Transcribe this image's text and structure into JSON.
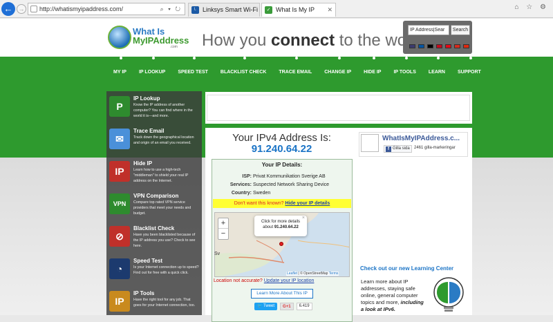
{
  "browser": {
    "url": "http://whatismyipaddress.com/",
    "address_controls": "⌕ ▾ ↻",
    "tabs": [
      {
        "label": "Linksys Smart Wi-Fi",
        "favicon": "ᴸ"
      },
      {
        "label": "What Is My IP Address? IP A...",
        "favicon": "✓",
        "close": "✕"
      }
    ],
    "window_icons": "⌂ ☆ ⚙"
  },
  "header": {
    "logo_line1": "What Is",
    "logo_line2": "MyIPAddress",
    "logo_dotcom": ".com",
    "tagline_pre": "How you ",
    "tagline_bold": "connect",
    "tagline_post": " to the world",
    "search_placeholder": "IP Address|Sear",
    "search_button": "Search",
    "flag_colors": [
      "#3c3b6e",
      "#0055a4",
      "#000000",
      "#c60b1e",
      "#e30a17",
      "#d52b1e",
      "#de2910"
    ]
  },
  "nav": [
    "MY IP",
    "IP LOOKUP",
    "SPEED TEST",
    "BLACKLIST CHECK",
    "TRACE EMAIL",
    "CHANGE IP",
    "HIDE IP",
    "IP TOOLS",
    "LEARN",
    "SUPPORT"
  ],
  "sidebar": [
    {
      "title": "IP Lookup",
      "desc": "Know the IP address of another computer? You can find where in the world it is—and more.",
      "icon": "lookup-icon",
      "glyph": "P",
      "color": "#2e8b2e"
    },
    {
      "title": "Trace Email",
      "desc": "Track down the geographical location and origin of an email you received.",
      "icon": "map-pin-icon",
      "glyph": "✉",
      "color": "#4a90d9"
    },
    {
      "title": "Hide IP",
      "desc": "Learn how to use a high-tech \"middleman\" to shield your real IP address on the Internet.",
      "icon": "incognito-icon",
      "glyph": "IP",
      "color": "#c0302a"
    },
    {
      "title": "VPN Comparison",
      "desc": "Compare top rated VPN service providers that meet your needs and budget.",
      "icon": "vpn-icon",
      "glyph": "VPN",
      "color": "#2e8b2e"
    },
    {
      "title": "Blacklist Check",
      "desc": "Have you been blacklisted because of the IP address you use? Check to see here.",
      "icon": "blacklist-icon",
      "glyph": "⊘",
      "color": "#c0302a"
    },
    {
      "title": "Speed Test",
      "desc": "Is your Internet connection up to speed? Find out for free with a quick click.",
      "icon": "speedometer-icon",
      "glyph": "◔",
      "color": "#1c3a6e"
    },
    {
      "title": "IP Tools",
      "desc": "Have the right tool for any job. That goes for your Internet connection, too.",
      "icon": "toolbox-icon",
      "glyph": "IP",
      "color": "#c98a1e"
    }
  ],
  "main": {
    "ip_title": "Your IPv4 Address Is:",
    "ip_address": "91.240.64.22",
    "details_title": "Your IP Details:",
    "isp_label": "ISP:",
    "isp_value": "Privat Kommunikation Sverige AB",
    "services_label": "Services:",
    "services_value": "Suspected Network Sharing Device",
    "country_label": "Country:",
    "country_value": "Sweden",
    "warn_text": "Don't want this known?",
    "warn_link": "Hide your IP details",
    "popup_line1": "Click for more details",
    "popup_line2_pre": "about ",
    "popup_ip": "91.240.64.22",
    "map_label": "Sv",
    "map_attrib_leaflet": "Leaflet",
    "map_attrib_sep": " | © OpenStreetMap ",
    "map_attrib_terms": "Terms",
    "not_accurate": "Location not accurate?",
    "update_link": "Update your IP location",
    "learn_more": "Learn More About This IP",
    "tweet": "Tweet",
    "gplus": "G+1",
    "gplus_count": "6.419"
  },
  "right": {
    "fb_name": "WhatIsMyIPAddress.c...",
    "fb_like": "Gilla sida",
    "fb_count": "2461 gilla-markeringar",
    "lc_title": "Check out our new Learning Center",
    "lc_text": "Learn more about IP addresses, staying safe online, general computer topics and more, ",
    "lc_text_em": "including a look at IPv6."
  }
}
